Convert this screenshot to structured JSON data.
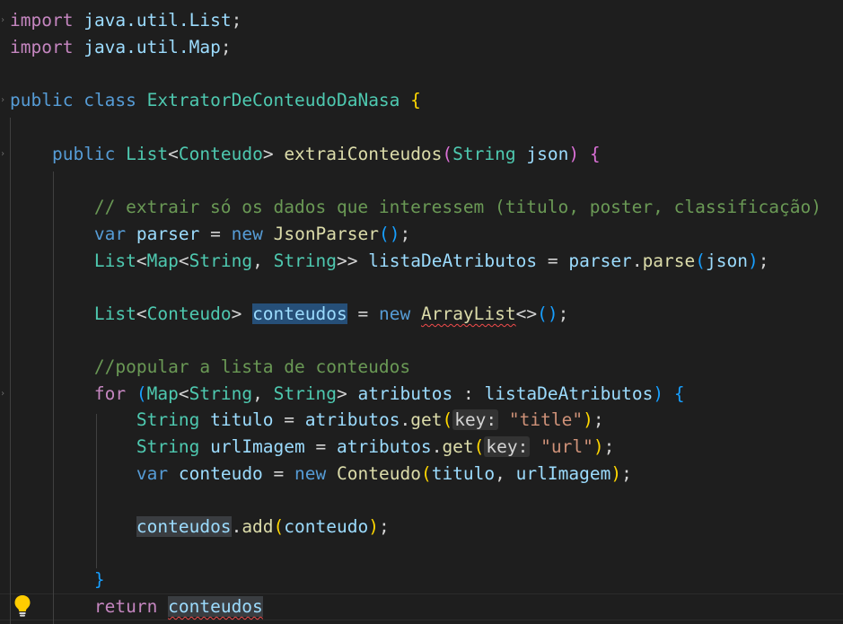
{
  "editor": {
    "language": "java",
    "lightbulb_icon": "lightbulb-icon",
    "colors": {
      "background": "#1e1e1e",
      "keyword": "#569cd6",
      "control": "#c586c0",
      "type": "#4ec9b0",
      "function": "#dcdcaa",
      "variable": "#9cdcfe",
      "string": "#ce9178",
      "comment": "#6a9955"
    },
    "lines": [
      {
        "import_kw": "import",
        "path": "java.util.List",
        "semi": ";"
      },
      {
        "import_kw": "import",
        "path": "java.util.Map",
        "semi": ";"
      },
      {
        "public": "public",
        "class": "class",
        "name": "ExtratorDeConteudoDaNasa",
        "brace": "{"
      },
      {
        "public": "public",
        "ret_type": "List",
        "lt": "<",
        "gen": "Conteudo",
        "gt": ">",
        "method": "extraiConteudos",
        "paren_open": "(",
        "param_type": "String",
        "param_name": "json",
        "paren_close": ")",
        "brace": "{"
      },
      {
        "comment": "// extrair só os dados que interessem (titulo, poster, classificação)"
      },
      {
        "var_kw": "var",
        "name": "parser",
        "eq": "=",
        "new_kw": "new",
        "type": "JsonParser",
        "parens": "()",
        "semi": ";"
      },
      {
        "t1": "List",
        "lt1": "<",
        "t2": "Map",
        "lt2": "<",
        "t3": "String",
        "comma": ",",
        "t4": "String",
        "gt": ">>",
        "name": "listaDeAtributos",
        "eq": "=",
        "obj": "parser",
        "dot": ".",
        "method": "parse",
        "po": "(",
        "arg": "json",
        "pc": ")",
        "semi": ";"
      },
      {
        "t1": "List",
        "lt": "<",
        "t2": "Conteudo",
        "gt": ">",
        "name": "conteudos",
        "eq": "=",
        "new_kw": "new",
        "type": "ArrayList",
        "diamond": "<>",
        "parens": "()",
        "semi": ";"
      },
      {
        "comment": "//popular a lista de conteudos"
      },
      {
        "for_kw": "for",
        "po": "(",
        "t1": "Map",
        "lt": "<",
        "t2": "String",
        "comma": ",",
        "t3": "String",
        "gt": ">",
        "name": "atributos",
        "colon": ":",
        "iter": "listaDeAtributos",
        "pc": ")",
        "brace": "{"
      },
      {
        "type": "String",
        "name": "titulo",
        "eq": "=",
        "obj": "atributos",
        "dot": ".",
        "method": "get",
        "po": "(",
        "hint": "key:",
        "arg": "\"title\"",
        "pc": ")",
        "semi": ";"
      },
      {
        "type": "String",
        "name": "urlImagem",
        "eq": "=",
        "obj": "atributos",
        "dot": ".",
        "method": "get",
        "po": "(",
        "hint": "key:",
        "arg": "\"url\"",
        "pc": ")",
        "semi": ";"
      },
      {
        "var_kw": "var",
        "name": "conteudo",
        "eq": "=",
        "new_kw": "new",
        "type": "Conteudo",
        "po": "(",
        "a1": "titulo",
        "comma": ",",
        "a2": "urlImagem",
        "pc": ")",
        "semi": ";"
      },
      {
        "obj": "conteudos",
        "dot": ".",
        "method": "add",
        "po": "(",
        "arg": "conteudo",
        "pc": ")",
        "semi": ";"
      },
      {
        "brace": "}"
      },
      {
        "return_kw": "return",
        "name": "conteudos"
      }
    ]
  }
}
